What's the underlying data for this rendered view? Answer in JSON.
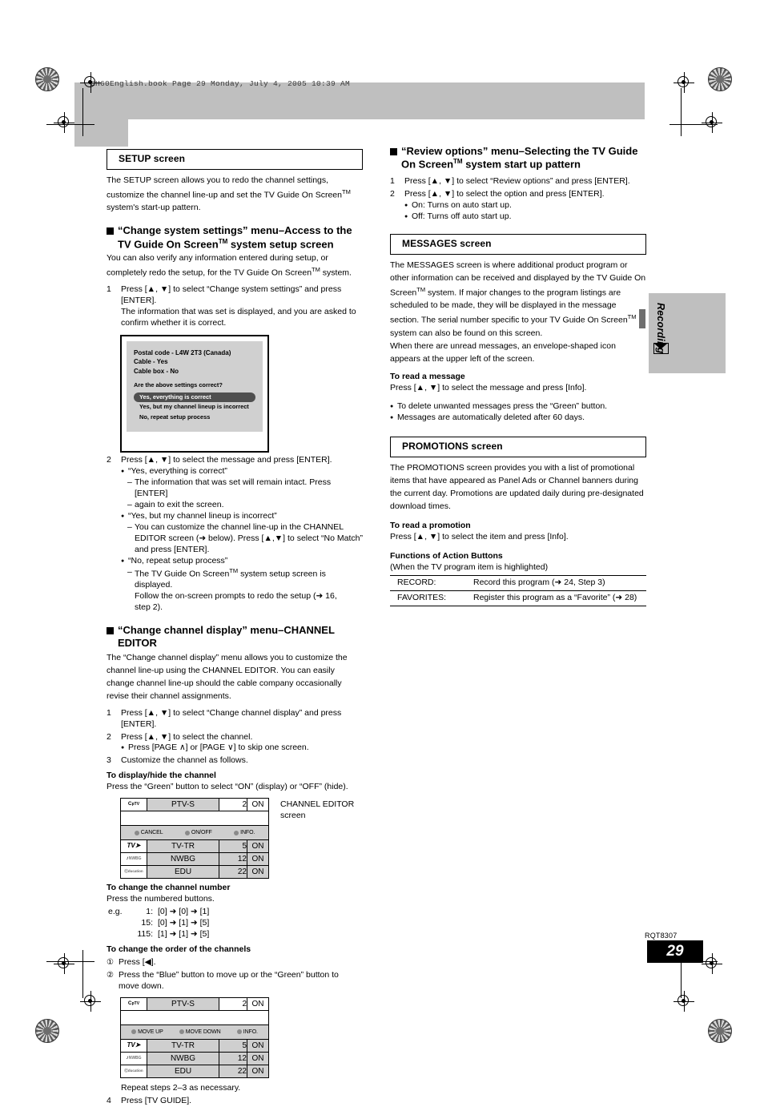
{
  "page": {
    "bookline": "EH60English.book  Page 29  Monday, July 4, 2005  10:39 AM",
    "side_tab": "Recording",
    "doc_code": "RQT8307",
    "page_number": "29"
  },
  "left": {
    "setup_section_title": "SETUP screen",
    "setup_intro_1": "The SETUP screen allows you to redo the channel settings,",
    "setup_intro_2": "customize the channel line-up and set the TV Guide On Screen",
    "setup_intro_3": "system's start-up pattern.",
    "h_change_system_1": "“Change system settings” menu–Access to the",
    "h_change_system_2": "TV Guide On Screen",
    "h_change_system_3": "system setup screen",
    "css_intro_1": "You can also verify any information entered during setup, or",
    "css_intro_2a": "completely redo the setup, for the TV Guide On Screen",
    "css_intro_2b": "system.",
    "step1_num": "1",
    "step1_a": "Press [▲, ▼] to select “Change system settings” and press",
    "step1_b": "[ENTER].",
    "step1_c": "The information that was set is displayed, and you are asked to",
    "step1_d": "confirm whether it is correct.",
    "dialog": {
      "line1": "Postal code - L4W 2T3 (Canada)",
      "line2": "Cable - Yes",
      "line3": "Cable box - No",
      "question": "Are the above settings correct?",
      "opt1": "Yes, everything is correct",
      "opt2": "Yes, but my channel lineup is incorrect",
      "opt3": "No, repeat setup process"
    },
    "step2_num": "2",
    "step2_a": "Press [▲, ▼] to select the message and press [ENTER].",
    "step2_b1": "“Yes, everything is correct”",
    "step2_b1d1": "The information that was set will remain intact. Press [ENTER]",
    "step2_b1d2": "again to exit the screen.",
    "step2_b2": "“Yes, but my channel lineup is incorrect”",
    "step2_b2d1": "You can customize the channel line-up in the CHANNEL",
    "step2_b2d2": "EDITOR screen (➜ below). Press [▲,▼] to select “No Match”",
    "step2_b2d3": "and press [ENTER].",
    "step2_b3": "“No, repeat setup process”",
    "step2_b3d1a": "The TV Guide On Screen",
    "step2_b3d1b": "system setup screen is displayed.",
    "step2_b3d2": "Follow the on-screen prompts to redo the setup (➜ 16,",
    "step2_b3d3": "step 2).",
    "h_change_display_1": "“Change channel display” menu–CHANNEL",
    "h_change_display_2": "EDITOR",
    "ccd_intro_1": "The “Change channel display” menu allows you to customize the",
    "ccd_intro_2": "channel line-up using the CHANNEL EDITOR. You can easily",
    "ccd_intro_3": "change channel line-up should the cable company occasionally",
    "ccd_intro_4": "revise their channel assignments.",
    "ccd_step1_num": "1",
    "ccd_step1_a": "Press [▲, ▼] to select “Change channel display” and press",
    "ccd_step1_b": "[ENTER].",
    "ccd_step2_num": "2",
    "ccd_step2_a": "Press [▲, ▼] to select the channel.",
    "ccd_step2_sub": "Press [PAGE ∧] or [PAGE ∨] to skip one screen.",
    "ccd_step3_num": "3",
    "ccd_step3_a": "Customize the channel as follows.",
    "display_hide_head": "To display/hide the channel",
    "display_hide_text": "Press the “Green” button to select “ON” (display) or “OFF” (hide).",
    "ce_caption_1": "CHANNEL EDITOR",
    "ce_caption_2": "screen",
    "channel_table_1": {
      "actions": [
        "CANCEL",
        "ON/OFF",
        "INFO."
      ],
      "rows": [
        {
          "icon": "C",
          "icon_sub": "pTV",
          "name": "PTV-S",
          "num": "2",
          "state": "ON",
          "highlight": "top"
        },
        {
          "icon": "TV",
          "icon_sub": "➤",
          "name": "TV-TR",
          "num": "5",
          "state": "ON"
        },
        {
          "icon": "♪",
          "icon_sub": "NWBG",
          "name": "NWBG",
          "num": "12",
          "state": "ON"
        },
        {
          "icon": "ⓔ",
          "icon_sub": "ducation",
          "name": "EDU",
          "num": "22",
          "state": "ON"
        }
      ]
    },
    "change_number_head": "To change the channel number",
    "change_number_text": "Press the numbered buttons.",
    "eg_label": "e.g.",
    "eg_rows": [
      {
        "label": "1:",
        "keys": "[0] ➜ [0] ➜ [1]"
      },
      {
        "label": "15:",
        "keys": "[0] ➜ [1] ➜ [5]"
      },
      {
        "label": "115:",
        "keys": "[1] ➜ [1] ➜ [5]"
      }
    ],
    "change_order_head": "To change the order of the channels",
    "order_1_num": "①",
    "order_1": "Press [◀].",
    "order_2_num": "②",
    "order_2a": "Press the “Blue” button to move up or the “Green” button to",
    "order_2b": "move down.",
    "channel_table_2": {
      "actions": [
        "MOVE UP",
        "MOVE DOWN",
        "INFO."
      ],
      "rows": [
        {
          "icon": "C",
          "icon_sub": "pTV",
          "name": "PTV-S",
          "num": "2",
          "state": "ON",
          "highlight": "top"
        },
        {
          "icon": "TV",
          "icon_sub": "➤",
          "name": "TV-TR",
          "num": "5",
          "state": "ON"
        },
        {
          "icon": "♪",
          "icon_sub": "NWBG",
          "name": "NWBG",
          "num": "12",
          "state": "ON"
        },
        {
          "icon": "ⓔ",
          "icon_sub": "ducation",
          "name": "EDU",
          "num": "22",
          "state": "ON"
        }
      ]
    },
    "repeat_text": "Repeat steps 2–3 as necessary.",
    "step4_num": "4",
    "step4_text": "Press [TV GUIDE]."
  },
  "right": {
    "h_review_1": "“Review options” menu–Selecting the TV Guide",
    "h_review_2": "On Screen",
    "h_review_3": "system start up pattern",
    "rev_step1_num": "1",
    "rev_step1": "Press [▲, ▼] to select “Review options” and press [ENTER].",
    "rev_step2_num": "2",
    "rev_step2": "Press [▲, ▼] to select the option and press [ENTER].",
    "rev_on": "On:  Turns on auto start up.",
    "rev_off": "Off:  Turns off auto start up.",
    "messages_section_title": "MESSAGES screen",
    "msg_1": "The MESSAGES screen is where additional product program or",
    "msg_2": "other information can be received and displayed by the TV Guide On",
    "msg_3a": "Screen",
    "msg_3b": "system. If major changes to the program listings are",
    "msg_4": "scheduled to be made, they will be displayed in the message",
    "msg_5a": "section. The serial number specific to your TV Guide On Screen",
    "msg_6": "system can also be found on this screen.",
    "msg_7": "When there are unread messages, an envelope-shaped icon",
    "msg_8": "appears at the upper left of the screen.",
    "read_message_head": "To read a message",
    "read_message_text": "Press [▲, ▼] to select the message and press [Info].",
    "msg_bullet_1": "To delete unwanted messages press the “Green” button.",
    "msg_bullet_2": "Messages are automatically deleted after 60 days.",
    "promotions_section_title": "PROMOTIONS screen",
    "promo_1": "The PROMOTIONS screen provides you with a list of promotional",
    "promo_2": "items that have appeared as Panel Ads or Channel banners during",
    "promo_3": "the current day. Promotions are updated daily during pre-designated",
    "promo_4": "download times.",
    "read_promo_head": "To read a promotion",
    "read_promo_text": "Press [▲, ▼] to select the item and press [Info].",
    "action_buttons_head": "Functions of Action Buttons",
    "action_buttons_sub": "(When the TV program item is highlighted)",
    "action_rows": [
      {
        "key": "RECORD:",
        "desc": "Record this program (➜ 24, Step 3)"
      },
      {
        "key": "FAVORITES:",
        "desc": "Register this program as a “Favorite” (➜ 28)"
      }
    ]
  }
}
